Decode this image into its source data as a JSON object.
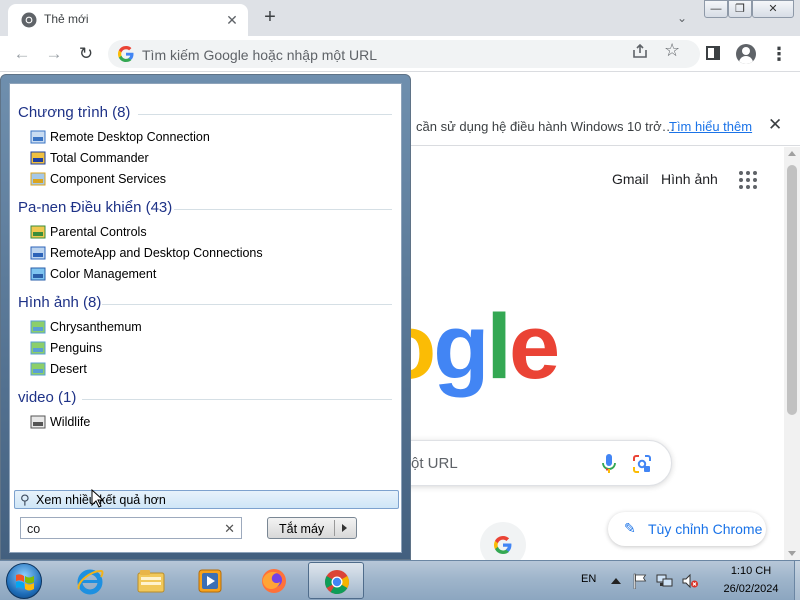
{
  "browser": {
    "tab_title": "Thẻ mới",
    "tab_close": "✕",
    "new_tab": "+",
    "omnibox_placeholder": "Tìm kiếm Google hoặc nhập một URL",
    "window_min": "—",
    "window_max": "❐",
    "window_close": "✕"
  },
  "infobar": {
    "message": "cần sử dụng hệ điều hành Windows 10 trở…",
    "link": "Tìm hiểu thêm",
    "close": "✕"
  },
  "newtab_page": {
    "gmail": "Gmail",
    "images": "Hình ảnh",
    "logo_letters": [
      "o",
      "g",
      "l",
      "e"
    ],
    "logo_colors": [
      "#fbbc05",
      "#4285f4",
      "#34a853",
      "#ea4335"
    ],
    "search_placeholder": "ột URL",
    "customize_label": "Tùy chỉnh Chrome"
  },
  "start_menu": {
    "sections": [
      {
        "title": "Chương trình (8)",
        "items": [
          {
            "label": "Remote Desktop Connection",
            "icon": "remote-desktop-icon"
          },
          {
            "label": "Total Commander",
            "icon": "total-commander-icon"
          },
          {
            "label": "Component Services",
            "icon": "component-services-icon"
          }
        ]
      },
      {
        "title": "Pa-nen Điều khiển (43)",
        "items": [
          {
            "label": "Parental Controls",
            "icon": "parental-controls-icon"
          },
          {
            "label": "RemoteApp and Desktop Connections",
            "icon": "remoteapp-icon"
          },
          {
            "label": "Color Management",
            "icon": "color-management-icon"
          }
        ]
      },
      {
        "title": "Hình ảnh (8)",
        "items": [
          {
            "label": "Chrysanthemum",
            "icon": "image-file-icon"
          },
          {
            "label": "Penguins",
            "icon": "image-file-icon"
          },
          {
            "label": "Desert",
            "icon": "image-file-icon"
          }
        ]
      },
      {
        "title": "video (1)",
        "items": [
          {
            "label": "Wildlife",
            "icon": "video-file-icon"
          }
        ]
      }
    ],
    "see_more": "Xem nhiều kết quả hơn",
    "search_value": "co",
    "search_clear": "✕",
    "shutdown_label": "Tắt máy"
  },
  "taskbar": {
    "language": "EN",
    "time": "1:10 CH",
    "date": "26/02/2024",
    "pinned": [
      "internet-explorer-icon",
      "windows-explorer-icon",
      "media-player-icon",
      "firefox-icon",
      "chrome-icon"
    ]
  }
}
